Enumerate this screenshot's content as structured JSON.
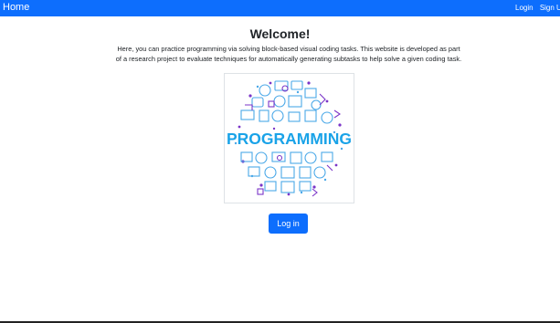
{
  "navbar": {
    "brand": "Home",
    "links": [
      "Login",
      "Sign Up"
    ]
  },
  "main": {
    "title": "Welcome!",
    "intro_line1": "Here, you can practice programming via solving block-based visual coding tasks. This website is developed as part",
    "intro_line2": "of a research project to evaluate techniques for automatically generating subtasks to help solve a given coding task.",
    "hero_word": "PROGRAMMING",
    "login_button": "Log in"
  },
  "colors": {
    "primary": "#0d6efd",
    "hero_word": "#1aa3e8",
    "icon_blue": "#4aa8e8",
    "icon_purple": "#7b35c8"
  }
}
